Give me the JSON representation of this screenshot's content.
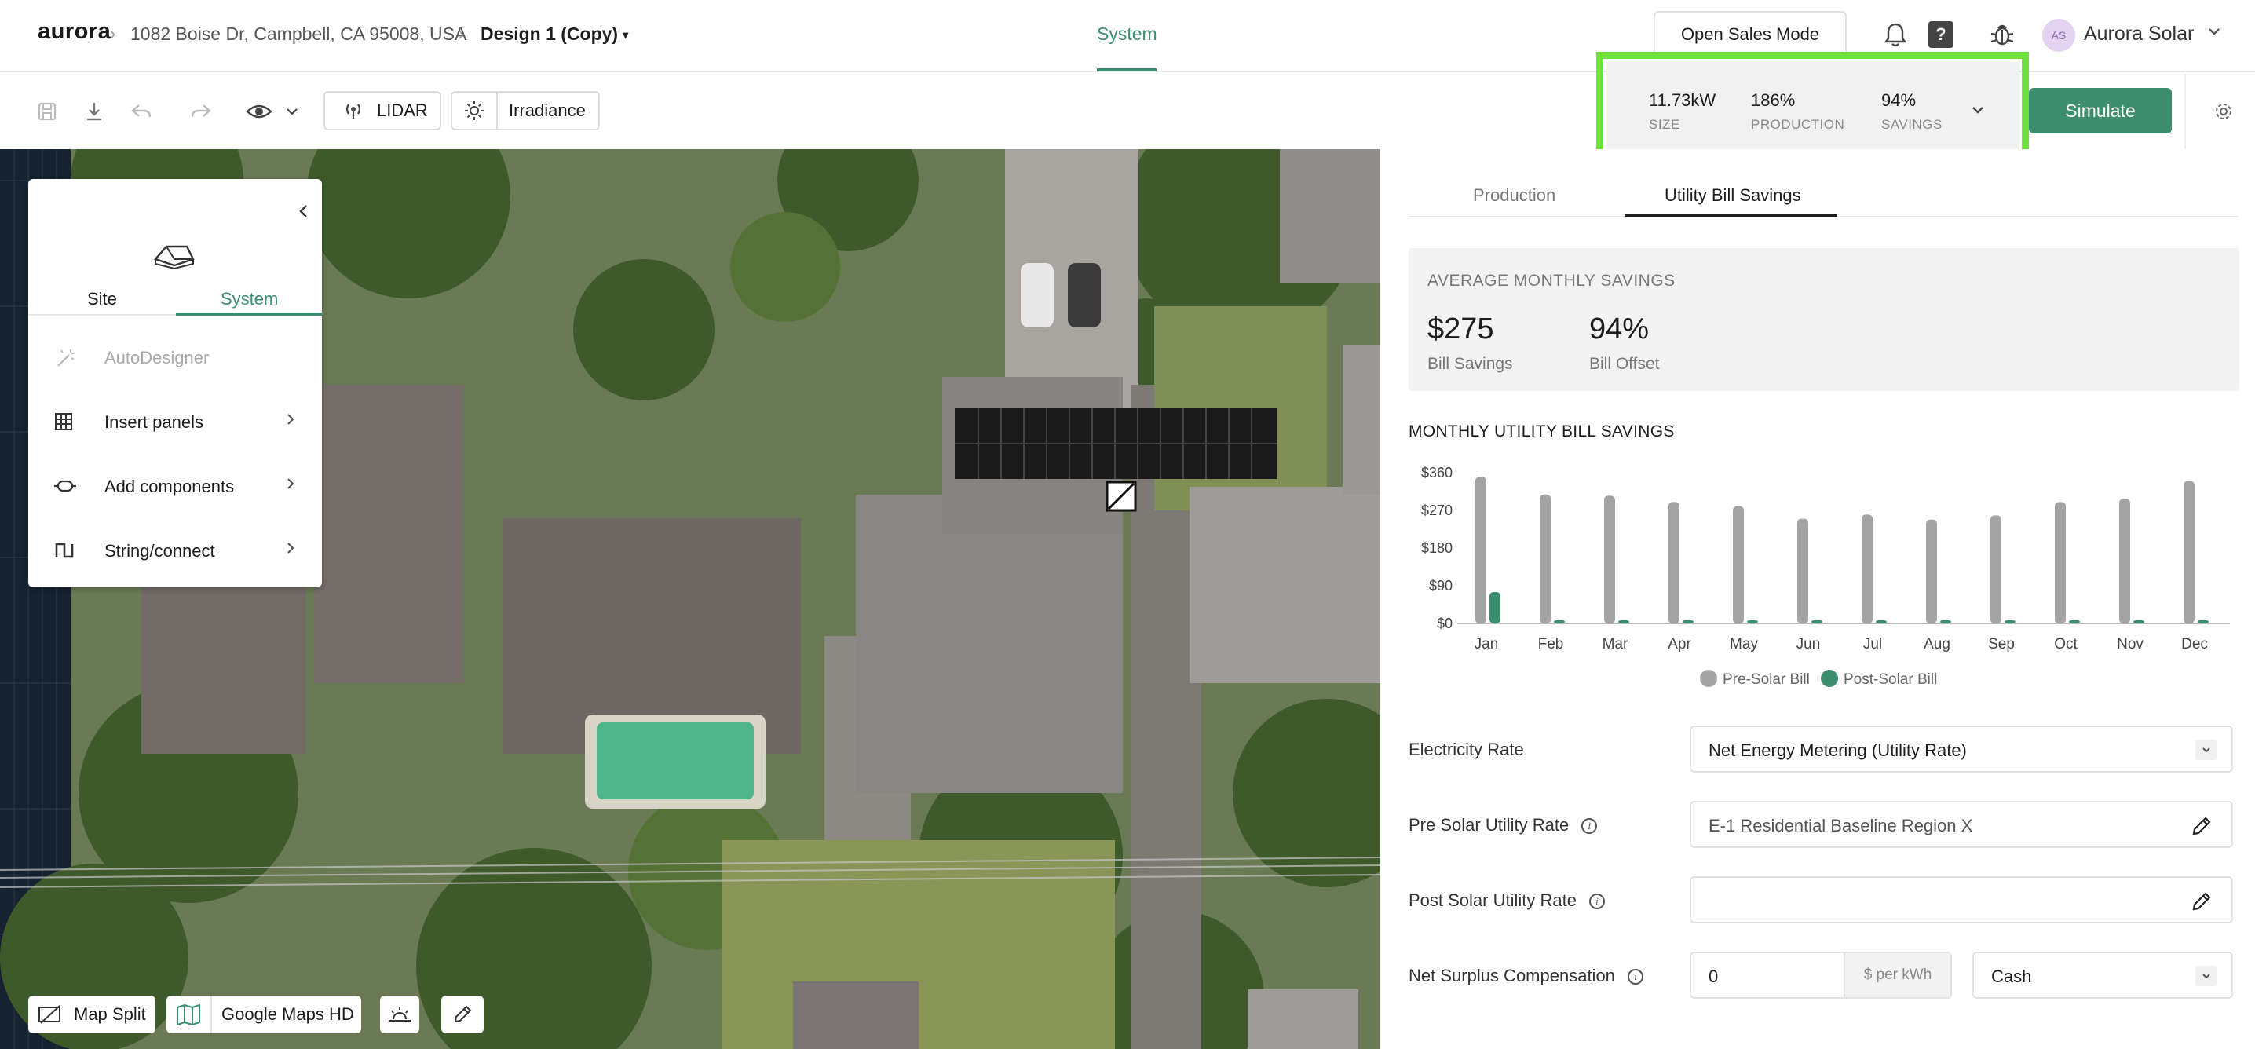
{
  "header": {
    "logo": "aurora",
    "address": "1082 Boise Dr, Campbell, CA 95008, USA",
    "design": "Design 1 (Copy)",
    "nav_system": "System",
    "open_sales_mode": "Open Sales Mode",
    "help": "?",
    "avatar_initials": "AS",
    "account_name": "Aurora Solar"
  },
  "toolbar": {
    "lidar_label": "LIDAR",
    "irradiance_label": "Irradiance",
    "stats": [
      {
        "value": "11.73kW",
        "label": "SIZE"
      },
      {
        "value": "186%",
        "label": "PRODUCTION"
      },
      {
        "value": "94%",
        "label": "SAVINGS"
      }
    ],
    "simulate_label": "Simulate"
  },
  "side_panel": {
    "tabs": [
      "Site",
      "System"
    ],
    "active_tab": "System",
    "items": [
      {
        "label": "AutoDesigner",
        "icon": "wand-icon",
        "disabled": true
      },
      {
        "label": "Insert panels",
        "icon": "grid-icon"
      },
      {
        "label": "Add components",
        "icon": "component-icon"
      },
      {
        "label": "String/connect",
        "icon": "string-icon"
      }
    ]
  },
  "map_controls": {
    "map_split": "Map Split",
    "google_maps_hd": "Google Maps HD"
  },
  "right_panel": {
    "tabs": [
      "Production",
      "Utility Bill Savings"
    ],
    "active_tab": "Utility Bill Savings",
    "avg_title": "AVERAGE MONTHLY SAVINGS",
    "bill_savings_value": "$275",
    "bill_savings_label": "Bill Savings",
    "bill_offset_value": "94%",
    "bill_offset_label": "Bill Offset",
    "chart_title": "MONTHLY UTILITY BILL SAVINGS",
    "form": {
      "electricity_rate_label": "Electricity Rate",
      "electricity_rate_value": "Net Energy Metering (Utility Rate)",
      "pre_solar_label": "Pre Solar Utility Rate",
      "pre_solar_value": "E-1 Residential Baseline Region X",
      "post_solar_label": "Post Solar Utility Rate",
      "post_solar_value": "",
      "nsc_label": "Net Surplus Compensation",
      "nsc_value": "0",
      "nsc_unit": "$ per kWh",
      "nsc_type": "Cash"
    }
  },
  "colors": {
    "accent": "#3c8e6e",
    "highlight": "#6fe03c",
    "pre_solar": "#a3a3a3",
    "post_solar": "#3c8e6e"
  },
  "chart_data": {
    "type": "bar",
    "categories": [
      "Jan",
      "Feb",
      "Mar",
      "Apr",
      "May",
      "Jun",
      "Jul",
      "Aug",
      "Sep",
      "Oct",
      "Nov",
      "Dec"
    ],
    "series": [
      {
        "name": "Pre-Solar Bill",
        "values": [
          350,
          308,
          305,
          290,
          280,
          250,
          260,
          248,
          258,
          290,
          298,
          340
        ]
      },
      {
        "name": "Post-Solar Bill",
        "values": [
          75,
          8,
          8,
          8,
          8,
          8,
          8,
          8,
          8,
          8,
          8,
          8
        ]
      }
    ],
    "y_ticks": [
      "$0",
      "$90",
      "$180",
      "$270",
      "$360"
    ],
    "ylim": [
      0,
      360
    ],
    "legend_position": "bottom",
    "grid": false
  }
}
